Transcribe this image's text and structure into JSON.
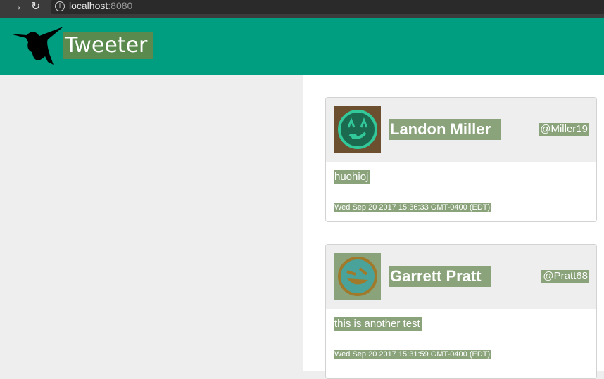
{
  "browser": {
    "url_host": "localhost",
    "url_port": ":8080"
  },
  "header": {
    "title": "Tweeter",
    "background": "#009e80"
  },
  "tweets": [
    {
      "name": "Landon Miller",
      "handle": "@Miller19",
      "message": "huohioj",
      "timestamp": "Wed Sep 20 2017 15:36:33 GMT-0400 (EDT)",
      "avatar_icon": "grimace-face-icon"
    },
    {
      "name": "Garrett Pratt",
      "handle": "@Pratt68",
      "message": "this is another test",
      "timestamp": "Wed Sep 20 2017 15:31:59 GMT-0400 (EDT)",
      "avatar_icon": "laughing-face-icon"
    }
  ]
}
